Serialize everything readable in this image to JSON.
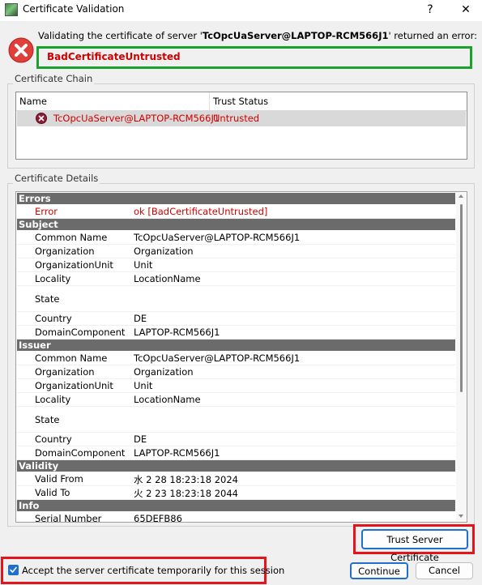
{
  "window": {
    "title": "Certificate Validation",
    "help": "?",
    "close": "✕"
  },
  "message": {
    "prefix": "Validating the certificate of server '",
    "server": "TcOpcUaServer@LAPTOP-RCM566J1",
    "suffix": "' returned an error:",
    "error_code": "BadCertificateUntrusted"
  },
  "chain": {
    "group_label": "Certificate Chain",
    "columns": [
      "Name",
      "Trust Status"
    ],
    "rows": [
      {
        "name": "TcOpcUaServer@LAPTOP-RCM566J1",
        "status": "Untrusted"
      }
    ]
  },
  "details": {
    "group_label": "Certificate Details",
    "sections": [
      {
        "title": "Errors",
        "rows": [
          {
            "key": "Error",
            "value": "ok [BadCertificateUntrusted]",
            "error": true
          }
        ]
      },
      {
        "title": "Subject",
        "rows": [
          {
            "key": "Common Name",
            "value": "TcOpcUaServer@LAPTOP-RCM566J1"
          },
          {
            "key": "Organization",
            "value": "Organization"
          },
          {
            "key": "OrganizationUnit",
            "value": "Unit"
          },
          {
            "key": "Locality",
            "value": "LocationName"
          },
          {
            "key": "State",
            "value": "",
            "tall": true
          },
          {
            "key": "Country",
            "value": "DE"
          },
          {
            "key": "DomainComponent",
            "value": "LAPTOP-RCM566J1"
          }
        ]
      },
      {
        "title": "Issuer",
        "rows": [
          {
            "key": "Common Name",
            "value": "TcOpcUaServer@LAPTOP-RCM566J1"
          },
          {
            "key": "Organization",
            "value": "Organization"
          },
          {
            "key": "OrganizationUnit",
            "value": "Unit"
          },
          {
            "key": "Locality",
            "value": "LocationName"
          },
          {
            "key": "State",
            "value": "",
            "tall": true
          },
          {
            "key": "Country",
            "value": "DE"
          },
          {
            "key": "DomainComponent",
            "value": "LAPTOP-RCM566J1"
          }
        ]
      },
      {
        "title": "Validity",
        "rows": [
          {
            "key": "Valid From",
            "value": "水 2 28 18:23:18 2024"
          },
          {
            "key": "Valid To",
            "value": "火 2 23 18:23:18 2044"
          }
        ]
      },
      {
        "title": "Info",
        "rows": [
          {
            "key": "Serial Number",
            "value": "65DEFB86"
          }
        ]
      }
    ]
  },
  "buttons": {
    "trust": "Trust Server Certificate",
    "continue": "Continue",
    "cancel": "Cancel"
  },
  "accept": {
    "label": "Accept the server certificate temporarily for this session",
    "checked": true
  },
  "colors": {
    "error": "#d00000",
    "highlight_green": "#19a32d",
    "highlight_red": "#e3141c",
    "accent": "#1f6fcc"
  }
}
